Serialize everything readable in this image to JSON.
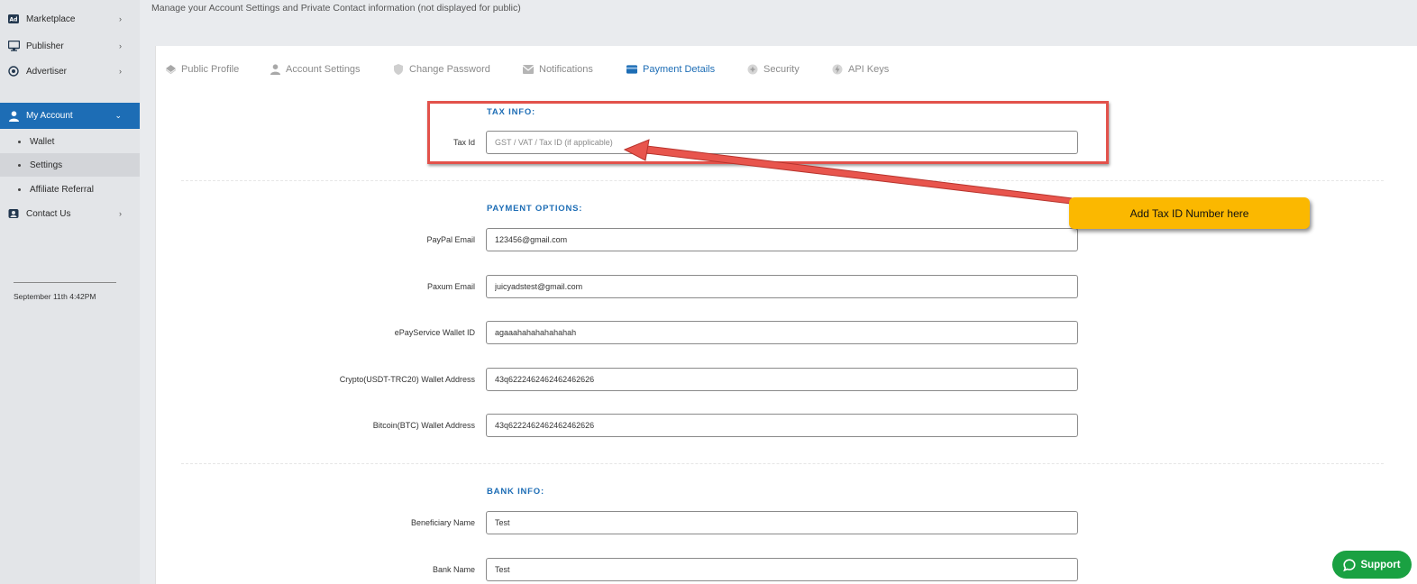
{
  "sidebar": {
    "items": [
      {
        "label": "Marketplace",
        "icon": "ad-icon"
      },
      {
        "label": "Publisher",
        "icon": "monitor-icon"
      },
      {
        "label": "Advertiser",
        "icon": "target-icon"
      },
      {
        "label": "My Account",
        "icon": "user-icon"
      },
      {
        "label": "Contact Us",
        "icon": "contact-icon"
      }
    ],
    "subitems": [
      {
        "label": "Wallet"
      },
      {
        "label": "Settings"
      },
      {
        "label": "Affiliate Referral"
      }
    ],
    "timestamp": "September 11th 4:42PM"
  },
  "header": {
    "description": "Manage your Account Settings and Private Contact information (not displayed for public)"
  },
  "tabs": [
    {
      "label": "Public Profile",
      "icon": "diamond-icon"
    },
    {
      "label": "Account Settings",
      "icon": "user-icon"
    },
    {
      "label": "Change Password",
      "icon": "shield-icon"
    },
    {
      "label": "Notifications",
      "icon": "envelope-icon"
    },
    {
      "label": "Payment Details",
      "icon": "credit-card-icon"
    },
    {
      "label": "Security",
      "icon": "security-icon"
    },
    {
      "label": "API Keys",
      "icon": "bolt-icon"
    }
  ],
  "tax": {
    "title": "TAX INFO:",
    "tax_id_label": "Tax Id",
    "tax_id_placeholder": "GST / VAT / Tax ID (if applicable)",
    "tax_id_value": ""
  },
  "payment": {
    "title": "PAYMENT OPTIONS:",
    "fields": [
      {
        "label": "PayPal Email",
        "value": "123456@gmail.com"
      },
      {
        "label": "Paxum Email",
        "value": "juicyadstest@gmail.com"
      },
      {
        "label": "ePayService Wallet ID",
        "value": "agaaahahahahahahah"
      },
      {
        "label": "Crypto(USDT-TRC20) Wallet Address",
        "value": "43q6222462462462462626"
      },
      {
        "label": "Bitcoin(BTC) Wallet Address",
        "value": "43q6222462462462462626"
      }
    ]
  },
  "bank": {
    "title": "BANK INFO:",
    "fields": [
      {
        "label": "Beneficiary Name",
        "value": "Test"
      },
      {
        "label": "Bank Name",
        "value": "Test"
      }
    ]
  },
  "annotation": {
    "callout_text": "Add Tax ID Number here",
    "highlight_color": "#e2524b",
    "callout_color": "#fbb800"
  },
  "support": {
    "label": "Support"
  },
  "colors": {
    "accent": "#1d6db5",
    "sidebar_bg": "#e3e5e8",
    "support_green": "#1aa142"
  }
}
